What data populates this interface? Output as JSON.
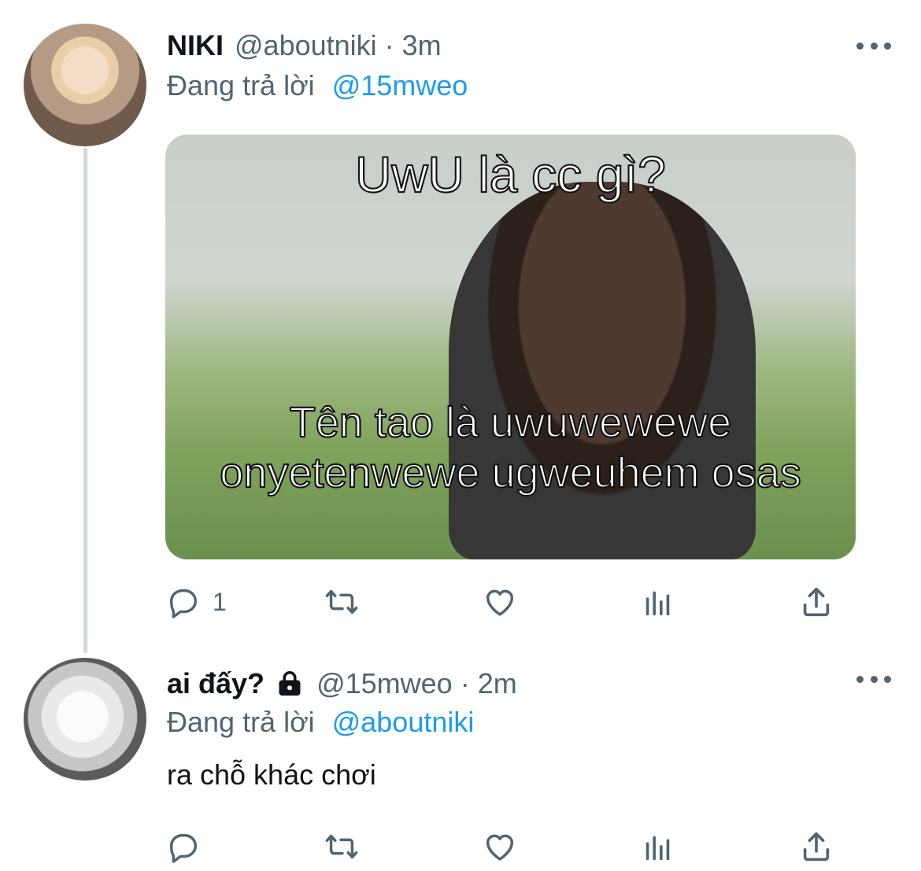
{
  "tweets": [
    {
      "name": "NIKI",
      "handle": "@aboutniki",
      "separator": "·",
      "time": "3m",
      "reply_label": "Đang trả lời",
      "reply_to": "@15mweo",
      "media": {
        "top_text": "UwU là cc gì?",
        "bottom_text": "Tên tao là uwuwewewe onyetenwewe ugweuhem osas"
      },
      "actions": {
        "reply_count": "1"
      }
    },
    {
      "name": "ai đấy?",
      "handle": "@15mweo",
      "separator": "·",
      "time": "2m",
      "reply_label": "Đang trả lời",
      "reply_to": "@aboutniki",
      "text": "ra chỗ khác chơi",
      "protected_icon": "lock-icon",
      "actions": {
        "reply_count": ""
      }
    }
  ],
  "icons": {
    "reply": "reply-icon",
    "retweet": "retweet-icon",
    "like": "heart-icon",
    "analytics": "analytics-icon",
    "share": "share-icon",
    "more": "more-icon"
  },
  "colors": {
    "text": "#0f1419",
    "secondary": "#536471",
    "accent": "#1d9bf0",
    "thread_line": "#cfd9de"
  }
}
